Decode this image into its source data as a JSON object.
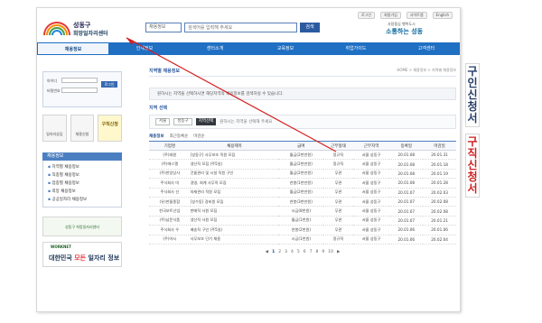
{
  "header": {
    "logo_line1": "성동구",
    "logo_line2": "희망일자리센터",
    "utility_links": [
      "로그인",
      "회원가입",
      "사이트맵",
      "English"
    ],
    "search_select": "채용정보",
    "search_placeholder": "검색어를 입력해 주세요",
    "search_button": "검색",
    "brand_small": "사람중심 행복도시",
    "brand_big": "소통하는 성동"
  },
  "nav": {
    "items": [
      "채용정보",
      "인재정보",
      "센터소개",
      "교육정보",
      "취업가이드",
      "고객센터"
    ],
    "active_index": 0
  },
  "sidebar": {
    "login_labels": [
      "아이디",
      "비밀번호"
    ],
    "login_button": "로그인",
    "quick_links": [
      "일자리상담",
      "채용신청",
      "구직신청"
    ],
    "menu_title": "채용정보",
    "menu_items": [
      "지역별 채용정보",
      "직종별 채용정보",
      "업종별 채용정보",
      "희망 채용정보",
      "공공일자리 채용정보"
    ],
    "banner1": "성동구 희망일자리센터",
    "banner2_small": "WORKNET",
    "banner2_prefix": "대한민국 ",
    "banner2_highlight": "모든",
    "banner2_suffix": " 일자리 정보"
  },
  "main": {
    "section_title": "지역별 채용정보",
    "breadcrumb": "HOME > 채용정보 > 지역별 채용정보",
    "notice": "원하시는 지역을 선택하시면 해당지역의 채용정보를 검색하실 수 있습니다.",
    "filter_title": "지역 선택",
    "filter_selects": [
      "서울",
      "성동구"
    ],
    "filter_button": "지역선택",
    "filter_hint": "원하시는 지역을 선택해 주세요",
    "tabs": [
      "채용정보",
      "최근등록순",
      "마감순"
    ],
    "columns": [
      "기업명",
      "채용제목",
      "급여",
      "근무형태",
      "근무지역",
      "등록일",
      "마감일"
    ],
    "rows": [
      [
        "(주)태원",
        "[성동구] 사무보조 직원 모집",
        "월급(2천만원)",
        "정규직",
        "서울 성동구",
        "20.01.08",
        "20.01.31"
      ],
      [
        "(주)에스엘",
        "생산직 모집 (주5일)",
        "월급(2천만원)",
        "정규직",
        "서울 성동구",
        "20.01.08",
        "20.01.18"
      ],
      [
        "(주)한양상사",
        "건물관리 및 시설 직원 구인",
        "월급(2천만원)",
        "무관",
        "서울 성동구",
        "20.01.08",
        "20.01.19"
      ],
      [
        "주식회사 미",
        "경영, 회계 사무직 모집",
        "연봉(1천만원)",
        "무관",
        "서울 성동구",
        "20.01.08",
        "20.01.28"
      ],
      [
        "주식회사 신",
        "자재관리 직원 모집",
        "월급(2천만원)",
        "무관",
        "서울 성동구",
        "20.01.07",
        "20.02.03"
      ],
      [
        "(유)한울종합",
        "[성수동] 경비원 모집",
        "연봉(3천만원)",
        "무관",
        "서울 성동구",
        "20.01.07",
        "20.02.08"
      ],
      [
        "한국보트산업",
        "판매직 사원 모집",
        "시급(8천원)",
        "무관",
        "서울 성동구",
        "20.01.07",
        "20.02.08"
      ],
      [
        "(주)남문식품",
        "생산직 사원 모집",
        "월급(1천원)",
        "무관",
        "서울 성동구",
        "20.01.07",
        "20.01.21"
      ],
      [
        "주식회사 우",
        "배송직 구인 (주5일)",
        "연봉(2천원)",
        "무관",
        "서울 성동구",
        "20.01.06",
        "20.01.06"
      ],
      [
        "(주)아시",
        "사무보조 단기 채용",
        "시급(1천원)",
        "정규직",
        "서울 성동구",
        "20.01.06",
        "20.02.04"
      ]
    ],
    "pager": [
      "◀",
      "1",
      "2",
      "3",
      "4",
      "5",
      "6",
      "7",
      "8",
      "9",
      "10",
      "▶"
    ]
  },
  "annotations": {
    "blue_label": "구인신청서",
    "red_label": "구직신청서"
  },
  "colors": {
    "nav": "#1f6fc3",
    "arrow_red": "#d61f1f",
    "accent": "#2c5aa0"
  }
}
